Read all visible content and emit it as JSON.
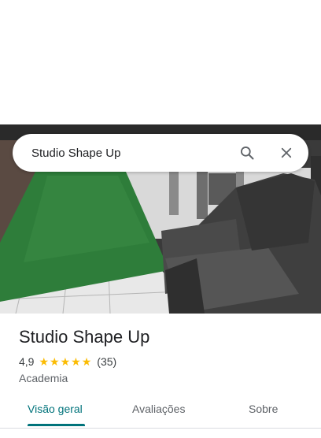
{
  "search": {
    "query": "Studio Shape Up"
  },
  "place": {
    "name": "Studio Shape Up",
    "rating": "4,9",
    "star_count": 5,
    "reviews_count": "(35)",
    "category": "Academia"
  },
  "tabs": [
    {
      "label": "Visão geral",
      "active": true
    },
    {
      "label": "Avaliações",
      "active": false
    },
    {
      "label": "Sobre",
      "active": false
    }
  ],
  "colors": {
    "accent": "#00737b",
    "star": "#fbbc04",
    "title": "#202124"
  },
  "icons": {
    "search": "search-icon",
    "close": "close-icon",
    "star": "star-icon"
  }
}
